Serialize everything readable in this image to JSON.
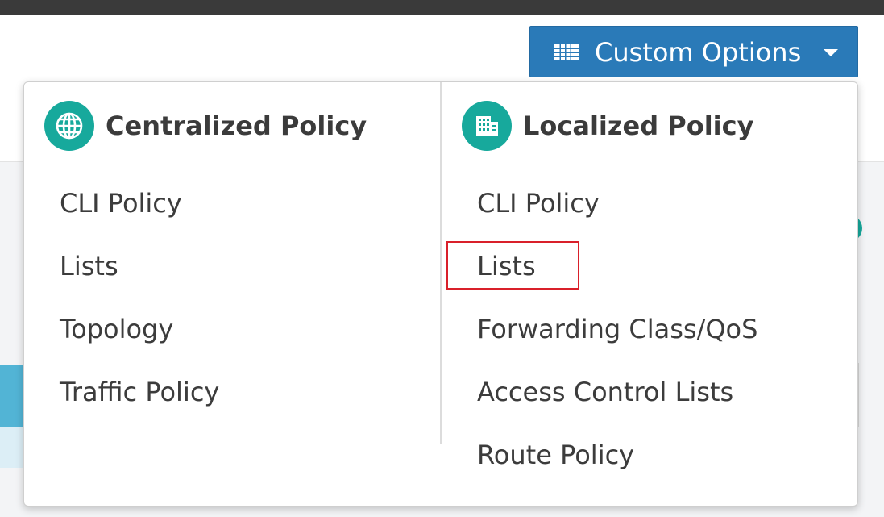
{
  "toolbar": {
    "custom_options_label": "Custom Options",
    "grid_icon": "grid-icon",
    "caret_icon": "caret-down-icon"
  },
  "dropdown": {
    "centralized": {
      "title": "Centralized Policy",
      "icon": "globe-icon",
      "items": [
        {
          "label": "CLI Policy"
        },
        {
          "label": "Lists"
        },
        {
          "label": "Topology"
        },
        {
          "label": "Traffic Policy"
        }
      ]
    },
    "localized": {
      "title": "Localized Policy",
      "icon": "building-icon",
      "items": [
        {
          "label": "CLI Policy"
        },
        {
          "label": "Lists",
          "highlighted": true
        },
        {
          "label": "Forwarding Class/QoS"
        },
        {
          "label": "Access Control Lists"
        },
        {
          "label": "Route Policy"
        }
      ]
    }
  },
  "colors": {
    "button_blue": "#2a7ab8",
    "icon_teal": "#17a99c",
    "highlight_red": "#d9202a",
    "text_dark": "#3c3c3c"
  }
}
